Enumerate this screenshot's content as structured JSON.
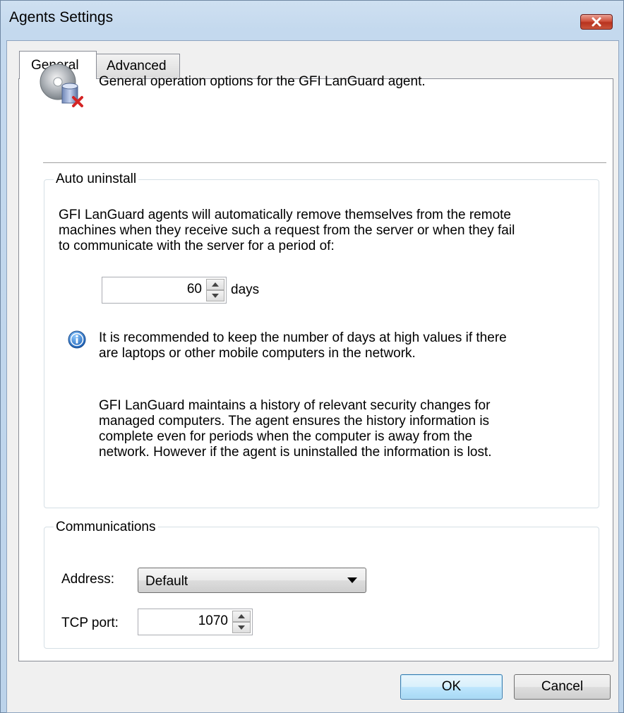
{
  "window": {
    "title": "Agents Settings",
    "close_label": "x"
  },
  "tabs": [
    {
      "label": "General",
      "selected": true
    },
    {
      "label": "Advanced",
      "selected": false
    }
  ],
  "header": {
    "icon": "cd-agent-remove-icon",
    "text": "General operation options for the GFI LanGuard agent."
  },
  "auto_uninstall": {
    "legend": "Auto uninstall",
    "description_lines": [
      "GFI LanGuard agents will automatically remove themselves from the remote",
      "machines when they receive such a request from the server or when they fail",
      "to communicate with the server for a period of:"
    ],
    "days_value": "60",
    "days_unit": "days",
    "info_icon": "info-icon",
    "info_lines": [
      "It is recommended to keep the number of days at high values if there",
      "are laptops or other mobile computers in the network."
    ],
    "history_lines": [
      "GFI LanGuard maintains a history of relevant security changes for",
      "managed computers. The agent ensures the history information is",
      "complete even for periods when the computer is away from the",
      "network. However if the agent is uninstalled the information is lost."
    ]
  },
  "communications": {
    "legend": "Communications",
    "address_label": "Address:",
    "address_value": "Default",
    "port_label": "TCP port:",
    "port_value": "1070"
  },
  "buttons": {
    "ok": "OK",
    "cancel": "Cancel"
  },
  "colors": {
    "accent": "#3c7fb1",
    "close": "#c9553c",
    "info": "#1a6fc9"
  }
}
